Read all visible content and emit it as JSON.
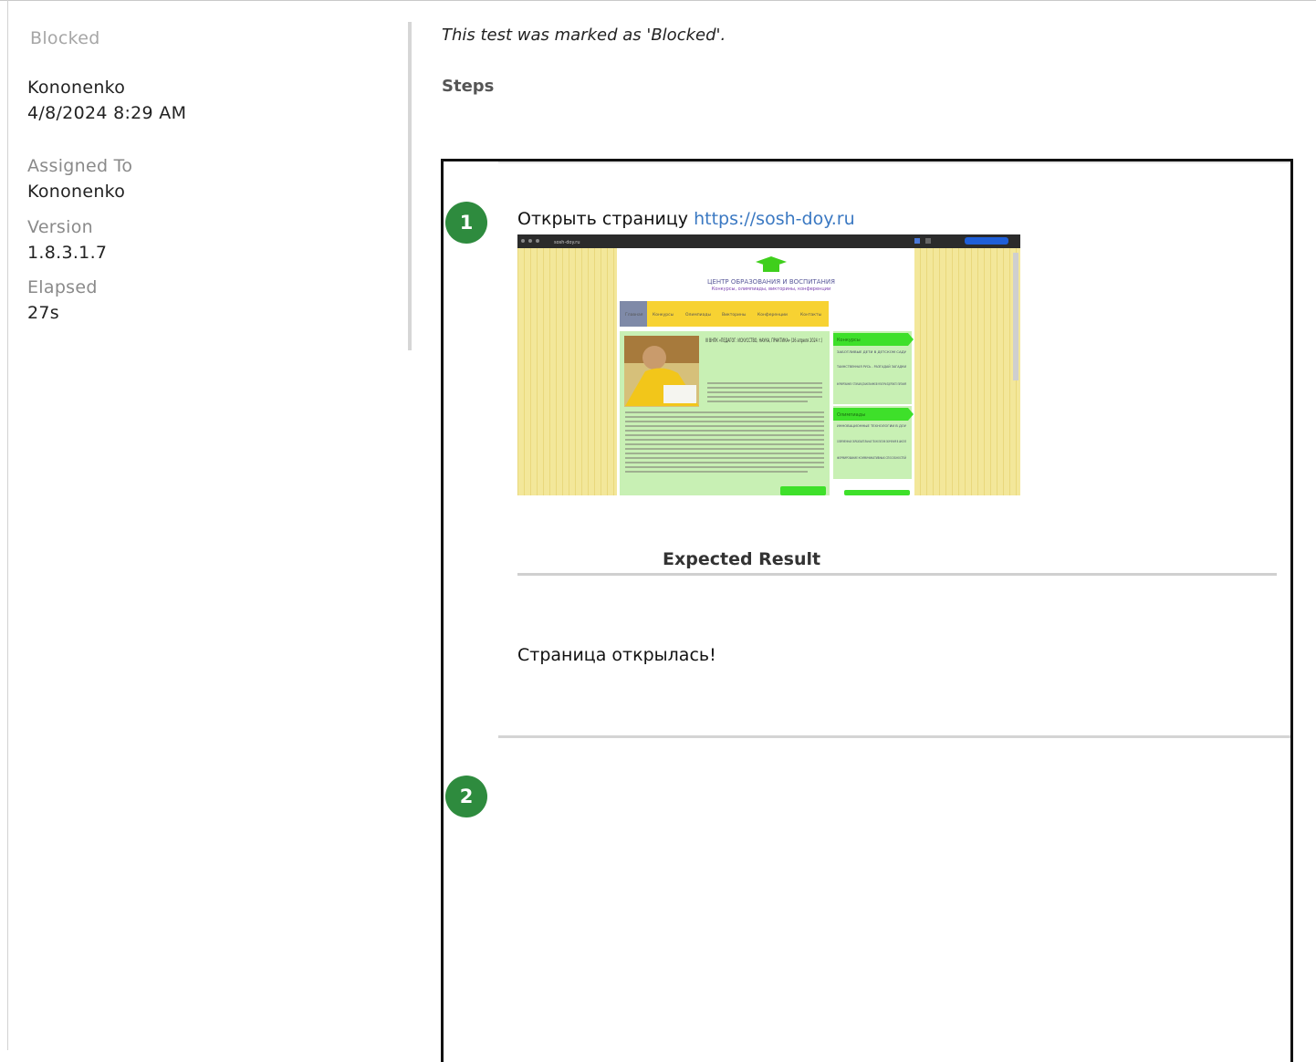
{
  "sidebar": {
    "status": "Blocked",
    "user": "Kononenko",
    "datetime": "4/8/2024 8:29 AM",
    "assigned_label": "Assigned To",
    "assigned_value": "Kononenko",
    "version_label": "Version",
    "version_value": "1.8.3.1.7",
    "elapsed_label": "Elapsed",
    "elapsed_value": "27s"
  },
  "main": {
    "blocked_message": "This test was marked as 'Blocked'.",
    "steps_heading": "Steps",
    "steps": [
      {
        "number": "1",
        "text": "Открыть страницу ",
        "link": "https://sosh-doy.ru",
        "expected_heading": "Expected Result",
        "expected_text": "Страница открылась!"
      },
      {
        "number": "2"
      }
    ]
  },
  "screenshot": {
    "url": "sosh-doy.ru",
    "site_title": "ЦЕНТР ОБРАЗОВАНИЯ И ВОСПИТАНИЯ",
    "site_subtitle": "Конкурсы, олимпиады, викторины, конференции",
    "nav": [
      "Главная",
      "Конкурсы",
      "Олимпиады",
      "Викторины",
      "Конференции",
      "Контакты"
    ],
    "article_title": "III ВНПК «ПЕДАГОГ: ИСКУССТВО, НАУКА, ПРАКТИКА» (26 апреля 2024 г.)",
    "side_sections": [
      "Конкурсы",
      "Олимпиады"
    ],
    "side_links": [
      "ЗАБОТЛИВЫЕ ДЕТИ В ДЕТСКОМ САДУ",
      "ТАИНСТВЕННАЯ РУСЬ - РАЗГАДАЙ ЗАГАДКИ",
      "ФОРМИРОВАНИЕ У СТАРШИХ ДОШКОЛЬНИКОВ КУЛЬТУРЫ ЗДОРОВОГО ПИТАНИЯ",
      "ИННОВАЦИОННЫЕ ТЕХНОЛОГИИ В ДОУ",
      "СОВРЕМЕННЫЕ ОБРАЗОВАТЕЛЬНЫЕ ТЕХНОЛОГИИ ОБУЧЕНИЯ В ШКОЛЕ",
      "ФОРМИРОВАНИЕ КОММУНИКАТИВНЫХ СПОСОБНОСТЕЙ"
    ],
    "colors": {
      "bg": "#f3e79a",
      "green": "#3ee02a",
      "content": "#c8f0b4"
    }
  }
}
